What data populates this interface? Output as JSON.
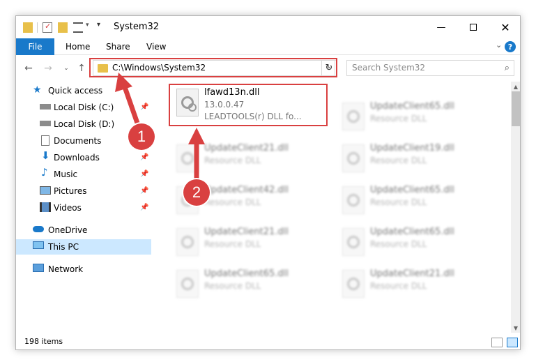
{
  "window": {
    "title": "System32"
  },
  "ribbon": {
    "file": "File",
    "tabs": [
      "Home",
      "Share",
      "View"
    ]
  },
  "address": {
    "path": "C:\\Windows\\System32"
  },
  "search": {
    "placeholder": "Search System32"
  },
  "sidebar": {
    "items": [
      {
        "label": "Quick access",
        "pinned": false
      },
      {
        "label": "Local Disk (C:)",
        "pinned": true
      },
      {
        "label": "Local Disk (D:)",
        "pinned": false
      },
      {
        "label": "Documents",
        "pinned": true
      },
      {
        "label": "Downloads",
        "pinned": true
      },
      {
        "label": "Music",
        "pinned": true
      },
      {
        "label": "Pictures",
        "pinned": true
      },
      {
        "label": "Videos",
        "pinned": true
      },
      {
        "label": "OneDrive",
        "pinned": false
      },
      {
        "label": "This PC",
        "pinned": false,
        "selected": true
      },
      {
        "label": "Network",
        "pinned": false
      }
    ]
  },
  "files": {
    "highlighted": {
      "name": "lfawd13n.dll",
      "version": "13.0.0.47",
      "description": "LEADTOOLS(r) DLL fo..."
    },
    "left_col": [
      {
        "name": "UpdateClient21.dll",
        "type": "Resource DLL"
      },
      {
        "name": "UpdateClient42.dll",
        "type": "Resource DLL"
      },
      {
        "name": "UpdateClient21.dll",
        "type": "Resource DLL"
      },
      {
        "name": "UpdateClient65.dll",
        "type": "Resource DLL"
      }
    ],
    "right_col": [
      {
        "name": "UpdateClient65.dll",
        "type": "Resource DLL"
      },
      {
        "name": "UpdateClient19.dll",
        "type": "Resource DLL"
      },
      {
        "name": "UpdateClient65.dll",
        "type": "Resource DLL"
      },
      {
        "name": "UpdateClient65.dll",
        "type": "Resource DLL"
      },
      {
        "name": "UpdateClient21.dll",
        "type": "Resource DLL"
      }
    ]
  },
  "status": {
    "count": "198 items"
  },
  "callouts": {
    "one": "1",
    "two": "2"
  },
  "colors": {
    "accent": "#1979ca",
    "highlight": "#d94040",
    "selected": "#cce8ff"
  }
}
